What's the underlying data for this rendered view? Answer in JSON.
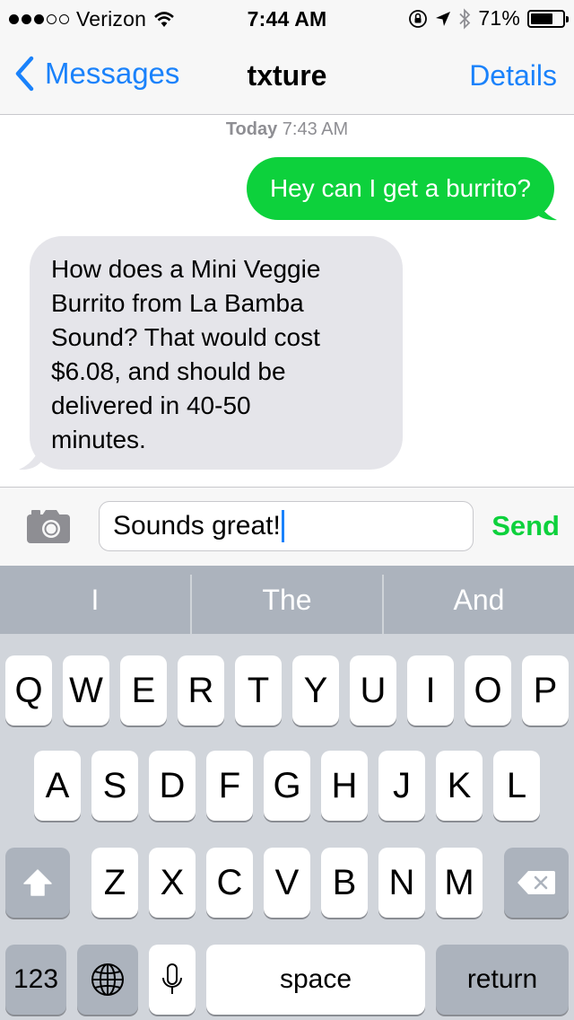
{
  "status_bar": {
    "carrier": "Verizon",
    "signal_bars_filled": 3,
    "signal_bars_total": 5,
    "time": "7:44 AM",
    "battery": "71%",
    "battery_level": 0.71,
    "icons": [
      "wifi-icon",
      "orientation-lock-icon",
      "location-arrow-icon",
      "bluetooth-icon",
      "battery-icon"
    ]
  },
  "nav": {
    "back_label": "Messages",
    "title": "txture",
    "details_label": "Details"
  },
  "conversation": {
    "timestamp_day": "Today",
    "timestamp_time": "7:43 AM",
    "messages": [
      {
        "direction": "outgoing",
        "lines": [
          "Hey can I get a burrito?"
        ]
      },
      {
        "direction": "incoming",
        "lines": [
          "How does a  Mini Veggie",
          "Burrito from La Bamba",
          "Sound? That would cost",
          "$6.08, and should be",
          "delivered in 40-50",
          "minutes."
        ]
      }
    ]
  },
  "input_bar": {
    "camera_icon": "camera-icon",
    "field_value": "Sounds great!",
    "send_label": "Send"
  },
  "predictive": [
    "I",
    "The",
    "And"
  ],
  "keyboard": {
    "row1": [
      "Q",
      "W",
      "E",
      "R",
      "T",
      "Y",
      "U",
      "I",
      "O",
      "P"
    ],
    "row2": [
      "A",
      "S",
      "D",
      "F",
      "G",
      "H",
      "J",
      "K",
      "L"
    ],
    "row3": [
      "Z",
      "X",
      "C",
      "V",
      "B",
      "N",
      "M"
    ],
    "numbers_label": "123",
    "space_label": "space",
    "return_label": "return",
    "shift_icon": "shift-icon",
    "delete_icon": "delete-icon",
    "globe_icon": "globe-icon",
    "mic_icon": "microphone-icon"
  },
  "colors": {
    "ios_blue": "#1a82fb",
    "imessage_green": "#0dd13c",
    "incoming_bubble": "#e5e5ea",
    "keyboard_bg": "#d1d5db",
    "predictive_bg": "#acb3bd"
  }
}
